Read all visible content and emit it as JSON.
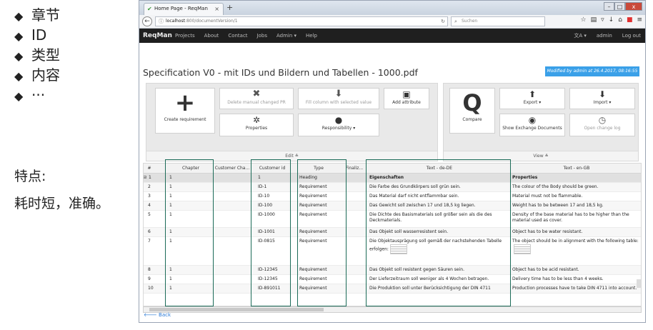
{
  "notes": {
    "bullets": [
      "章节",
      "ID",
      "类型",
      "内容",
      "···"
    ],
    "bullet_glyph": "◆",
    "feature_title": "特点:",
    "feature_text": "耗时短，准确。"
  },
  "browser": {
    "tab_title": "Home Page - ReqMan",
    "new_tab": "+",
    "url_host": "localhost",
    "url_path": ":800/documentVersion/1",
    "search_placeholder": "Suchen"
  },
  "app": {
    "brand": "ReqMan",
    "menu": [
      "Projects",
      "About",
      "Contact",
      "Jobs",
      "Admin ▾",
      "Help"
    ],
    "lang": "文A ▾",
    "user": "admin",
    "logout": "Log out"
  },
  "document": {
    "title": "Specification V0 - mit IDs und Bildern und Tabellen - 1000.pdf",
    "modified": "Modified by admin at 26.4.2017, 08:16:55"
  },
  "edit_panel": {
    "footer": "Edit ≙",
    "create_requirement": "Create requirement",
    "delete_changed": "Delete manual changed PR",
    "fill_column": "Fill column with selected value",
    "add_attribute": "Add attribute",
    "properties": "Properties",
    "responsibility": "Responsibility ▾"
  },
  "view_panel": {
    "footer": "View ≙",
    "compare": "Compare",
    "export": "Export ▾",
    "import": "Import ▾",
    "show_exchange": "Show Exchange Documents",
    "open_changelog": "Open change log"
  },
  "table": {
    "headers": [
      "#",
      "Chapter",
      "Customer Cha...",
      "Customer id",
      "Type",
      "Finaliz...",
      "Text - de-DE",
      "Text - en-GB"
    ],
    "rows": [
      {
        "n": "1",
        "chapter": "1",
        "cid": "1",
        "type": "Heading",
        "de": "Eigenschaften",
        "en": "Properties"
      },
      {
        "n": "2",
        "chapter": "1",
        "cid": "ID-1",
        "type": "Requirement",
        "de": "Die Farbe des Grundkörpers soll grün sein.",
        "en": "The colour of the Body should be green."
      },
      {
        "n": "3",
        "chapter": "1",
        "cid": "ID-10",
        "type": "Requirement",
        "de": "Das Material darf nicht entflammbar sein.",
        "en": "Material must not be flammable."
      },
      {
        "n": "4",
        "chapter": "1",
        "cid": "ID-100",
        "type": "Requirement",
        "de": "Das Gewicht soll zwischen 17 und 18,5 kg liegen.",
        "en": "Weight has to be between 17 and 18,5 kg."
      },
      {
        "n": "5",
        "chapter": "1",
        "cid": "ID-1000",
        "type": "Requirement",
        "de": "Die Dichte des Basismaterials soll größer sein als die des Deckmaterials.",
        "en": "Density of the base material has to be higher than the material used as cover."
      },
      {
        "n": "6",
        "chapter": "1",
        "cid": "ID-1001",
        "type": "Requirement",
        "de": "Das Objekt soll wasserresistent sein.",
        "en": "Object has to be water resistant."
      },
      {
        "n": "7",
        "chapter": "1",
        "cid": "ID-0815",
        "type": "Requirement",
        "de": "Die Objektausprägung soll gemäß der nachstehenden Tabelle erfolgen:",
        "en": "The object should be in alignment with the following table:"
      },
      {
        "n": "8",
        "chapter": "1",
        "cid": "ID-12345",
        "type": "Requirement",
        "de": "Das Objekt soll resistent gegen Säuren sein.",
        "en": "Object has to be acid resistant."
      },
      {
        "n": "9",
        "chapter": "1",
        "cid": "ID-12345",
        "type": "Requirement",
        "de": "Der Lieferzeitraum soll weniger als 4 Wochen betragen.",
        "en": "Delivery time has to be less than 4 weeks."
      },
      {
        "n": "10",
        "chapter": "1",
        "cid": "ID-891011",
        "type": "Requirement",
        "de": "Die Produktion soll unter Berücksichtigung der DIN 4711",
        "en": "Production processes have to take DIN 4711 into account."
      }
    ]
  },
  "back_link": "Back",
  "colors": {
    "highlight": "#1c6b58",
    "accent": "#3aa0e8",
    "appbar": "#1f1f1f"
  }
}
